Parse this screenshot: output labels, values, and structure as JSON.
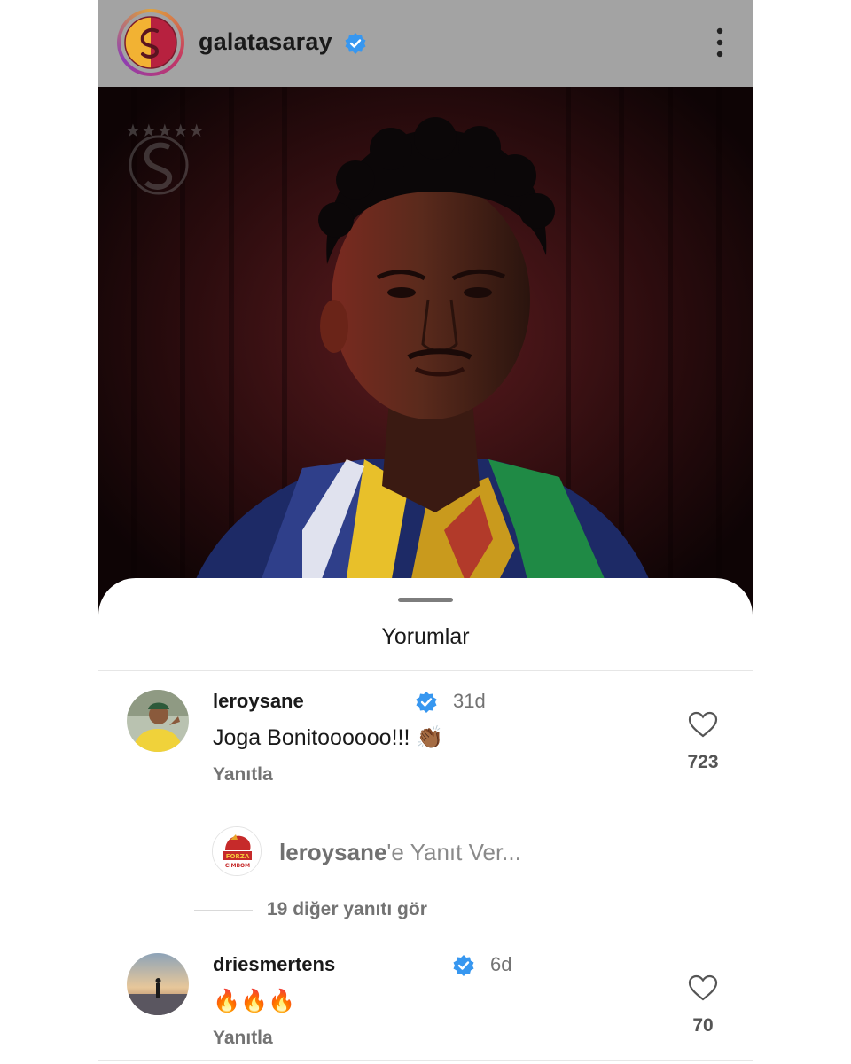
{
  "header": {
    "username": "galatasaray",
    "verified_icon": "verified-badge-icon",
    "more_icon": "more-vertical-icon"
  },
  "post": {
    "image_description_icon": "post-photo"
  },
  "comments_sheet": {
    "title": "Yorumlar",
    "comments": [
      {
        "username": "leroysane",
        "verified": true,
        "time": "31d",
        "text": "Joga Bonitoooooo!!! 👏🏾",
        "reply_label": "Yanıtla",
        "likes": "723"
      },
      {
        "username": "driesmertens",
        "verified": true,
        "time": "6d",
        "text": "🔥🔥🔥",
        "reply_label": "Yanıtla",
        "likes": "70"
      }
    ],
    "reply_input": {
      "target_user": "leroysane",
      "placeholder_suffix": "'e Yanıt Ver..."
    },
    "view_more_replies": "19 diğer yanıtı gör"
  },
  "colors": {
    "verified_blue": "#3797f0",
    "header_bg": "#a3a3a3",
    "muted_text": "#737373"
  }
}
